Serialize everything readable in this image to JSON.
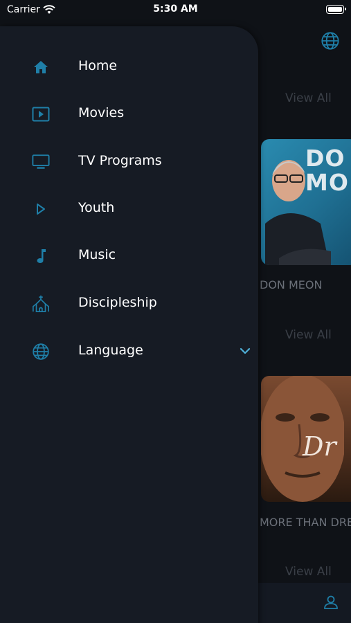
{
  "status": {
    "carrier": "Carrier",
    "time": "5:30 AM"
  },
  "background": {
    "view_all_1": "View All",
    "view_all_2": "View All",
    "view_all_3": "View All",
    "card_1": {
      "thumb_text": "DO\nMO",
      "title": "DON MEON"
    },
    "card_2": {
      "thumb_text": "Dr",
      "title": "MORE THAN DRE"
    }
  },
  "drawer": {
    "items": [
      {
        "label": "Home",
        "icon": "home-icon"
      },
      {
        "label": "Movies",
        "icon": "movie-icon"
      },
      {
        "label": "TV Programs",
        "icon": "tv-icon"
      },
      {
        "label": "Youth",
        "icon": "play-icon"
      },
      {
        "label": "Music",
        "icon": "music-note-icon"
      },
      {
        "label": "Discipleship",
        "icon": "church-icon"
      },
      {
        "label": "Language",
        "icon": "globe-icon"
      }
    ]
  },
  "colors": {
    "accent": "#1f7fa8",
    "chevron": "#4fb0d8",
    "drawer_bg": "#161b24",
    "app_bg": "#0f1217"
  }
}
